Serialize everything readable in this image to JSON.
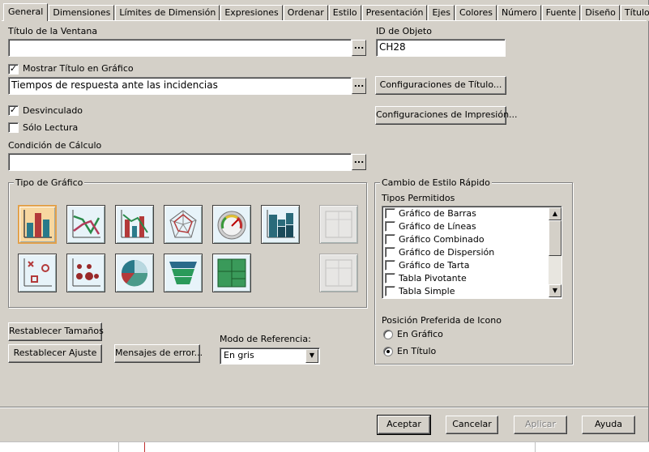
{
  "tabs": [
    "General",
    "Dimensiones",
    "Límites de Dimensión",
    "Expresiones",
    "Ordenar",
    "Estilo",
    "Presentación",
    "Ejes",
    "Colores",
    "Número",
    "Fuente",
    "Diseño",
    "Título"
  ],
  "active_tab": "General",
  "window_title_label": "Título de la Ventana",
  "window_title_value": "",
  "object_id_label": "ID de Objeto",
  "object_id_value": "CH28",
  "show_title_label": "Mostrar Título en Gráfico",
  "show_title_checked": true,
  "chart_title_value": "Tiempos de respuesta ante las incidencias",
  "title_settings_button": "Configuraciones de Título...",
  "print_settings_button": "Configuraciones de Impresión...",
  "detached_label": "Desvinculado",
  "detached_checked": true,
  "readonly_label": "Sólo Lectura",
  "readonly_checked": false,
  "calc_condition_label": "Condición de Cálculo",
  "calc_condition_value": "",
  "dots_label": "...",
  "chart_type_group": "Tipo de Gráfico",
  "chart_types": [
    {
      "name": "bar-chart-icon",
      "selected": true
    },
    {
      "name": "line-chart-icon"
    },
    {
      "name": "combo-chart-icon"
    },
    {
      "name": "radar-chart-icon"
    },
    {
      "name": "gauge-chart-icon"
    },
    {
      "name": "mekko-chart-icon"
    },
    {
      "name": "scatter-chart-icon"
    },
    {
      "name": "grid-chart-icon"
    },
    {
      "name": "pie-chart-icon"
    },
    {
      "name": "funnel-chart-icon"
    },
    {
      "name": "block-chart-icon"
    }
  ],
  "quick_style_group": "Cambio de Estilo Rápido",
  "allowed_types_label": "Tipos Permitidos",
  "allowed_types": [
    {
      "label": "Gráfico de Barras",
      "checked": false
    },
    {
      "label": "Gráfico de Líneas",
      "checked": false
    },
    {
      "label": "Gráfico Combinado",
      "checked": false
    },
    {
      "label": "Gráfico de Dispersión",
      "checked": false
    },
    {
      "label": "Gráfico de Tarta",
      "checked": false
    },
    {
      "label": "Tabla Pivotante",
      "checked": false
    },
    {
      "label": "Tabla Simple",
      "checked": false
    }
  ],
  "icon_position_label": "Posición Preferida de Icono",
  "icon_position_options": [
    "En Gráfico",
    "En Título"
  ],
  "icon_position_selected": "En Título",
  "reset_sizes_button": "Restablecer Tamaños",
  "reset_fit_button": "Restablecer Ajuste",
  "error_messages_button": "Mensajes de error...",
  "reference_mode_label": "Modo de Referencia:",
  "reference_mode_value": "En gris",
  "ok_button": "Aceptar",
  "cancel_button": "Cancelar",
  "apply_button": "Aplicar",
  "help_button": "Ayuda",
  "colors": {
    "dialog_bg": "#d4d0c8",
    "selected_chart_border": "#e3a14a",
    "chart_icon_bg": "#e7f3f9"
  }
}
